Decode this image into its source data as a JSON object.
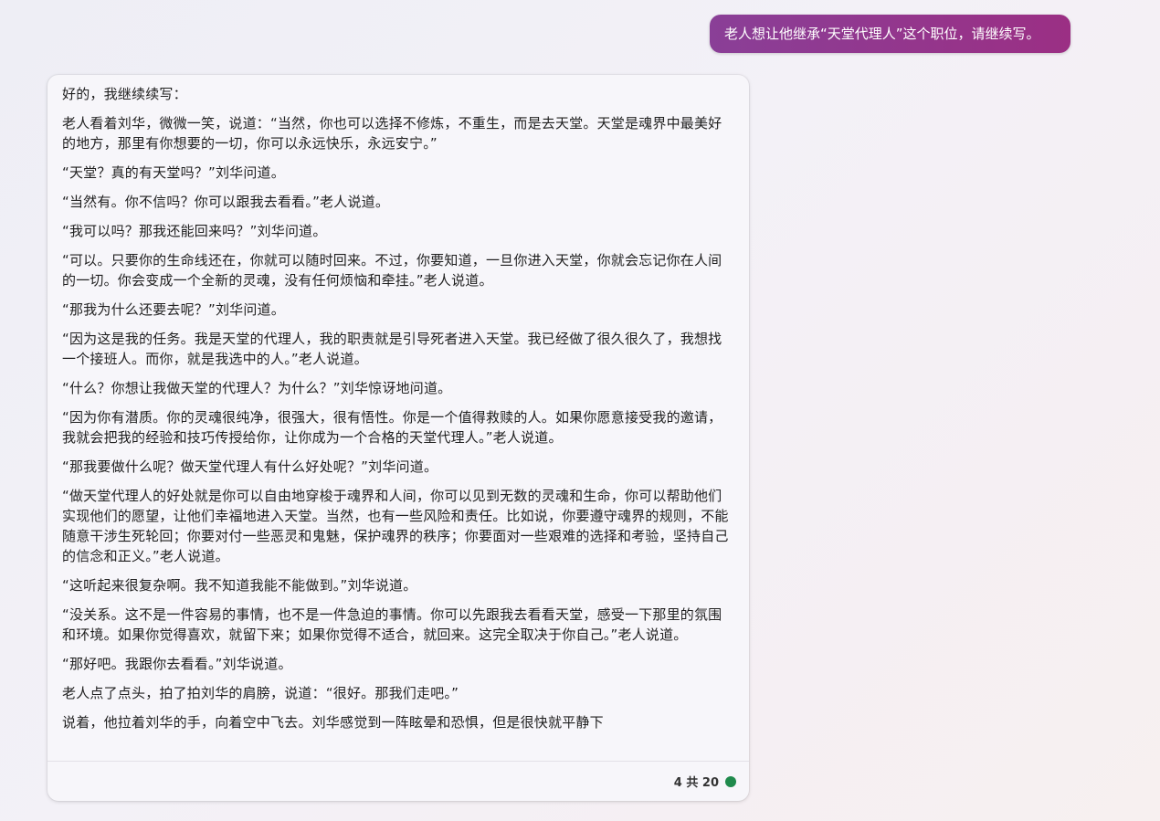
{
  "user_message": "老人想让他继承“天堂代理人”这个职位，请继续写。",
  "response": {
    "paragraphs": [
      "好的，我继续续写：",
      "老人看着刘华，微微一笑，说道：“当然，你也可以选择不修炼，不重生，而是去天堂。天堂是魂界中最美好的地方，那里有你想要的一切，你可以永远快乐，永远安宁。”",
      "“天堂？真的有天堂吗？”刘华问道。",
      "“当然有。你不信吗？你可以跟我去看看。”老人说道。",
      "“我可以吗？那我还能回来吗？”刘华问道。",
      "“可以。只要你的生命线还在，你就可以随时回来。不过，你要知道，一旦你进入天堂，你就会忘记你在人间的一切。你会变成一个全新的灵魂，没有任何烦恼和牵挂。”老人说道。",
      "“那我为什么还要去呢？”刘华问道。",
      "“因为这是我的任务。我是天堂的代理人，我的职责就是引导死者进入天堂。我已经做了很久很久了，我想找一个接班人。而你，就是我选中的人。”老人说道。",
      "“什么？你想让我做天堂的代理人？为什么？”刘华惊讶地问道。",
      "“因为你有潜质。你的灵魂很纯净，很强大，很有悟性。你是一个值得救赎的人。如果你愿意接受我的邀请，我就会把我的经验和技巧传授给你，让你成为一个合格的天堂代理人。”老人说道。",
      "“那我要做什么呢？做天堂代理人有什么好处呢？”刘华问道。",
      "“做天堂代理人的好处就是你可以自由地穿梭于魂界和人间，你可以见到无数的灵魂和生命，你可以帮助他们实现他们的愿望，让他们幸福地进入天堂。当然，也有一些风险和责任。比如说，你要遵守魂界的规则，不能随意干涉生死轮回；你要对付一些恶灵和鬼魅，保护魂界的秩序；你要面对一些艰难的选择和考验，坚持自己的信念和正义。”老人说道。",
      "“这听起来很复杂啊。我不知道我能不能做到。”刘华说道。",
      "“没关系。这不是一件容易的事情，也不是一件急迫的事情。你可以先跟我去看看天堂，感受一下那里的氛围和环境。如果你觉得喜欢，就留下来；如果你觉得不适合，就回来。这完全取决于你自己。”老人说道。",
      "“那好吧。我跟你去看看。”刘华说道。",
      "老人点了点头，拍了拍刘华的肩膀，说道：“很好。那我们走吧。”",
      "说着，他拉着刘华的手，向着空中飞去。刘华感觉到一阵眩晕和恐惧，但是很快就平静下"
    ],
    "counter": "4 共 20",
    "status_color": "#1f8a4c"
  }
}
